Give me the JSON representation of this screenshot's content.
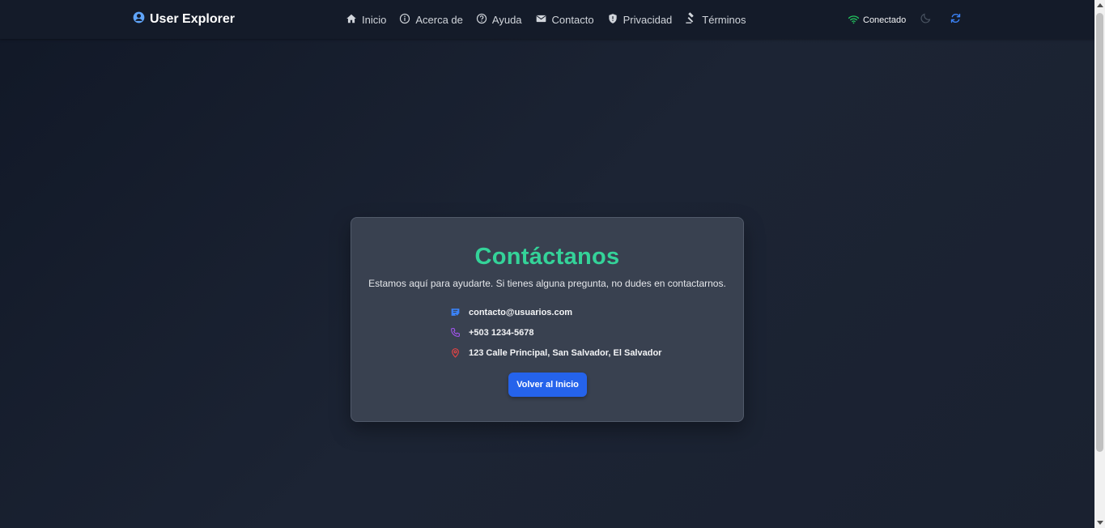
{
  "navbar": {
    "brand": "User Explorer",
    "links": [
      {
        "label": "Inicio",
        "icon": "home-icon"
      },
      {
        "label": "Acerca de",
        "icon": "info-icon"
      },
      {
        "label": "Ayuda",
        "icon": "help-icon"
      },
      {
        "label": "Contacto",
        "icon": "mail-icon"
      },
      {
        "label": "Privacidad",
        "icon": "shield-icon"
      },
      {
        "label": "Términos",
        "icon": "gavel-icon"
      }
    ],
    "status_label": "Conectado"
  },
  "card": {
    "title": "Contáctanos",
    "subtitle": "Estamos aquí para ayudarte. Si tienes alguna pregunta, no dudes en contactarnos.",
    "email": "contacto@usuarios.com",
    "phone": "+503 1234-5678",
    "address": "123 Calle Principal, San Salvador, El Salvador",
    "button_label": "Volver al Inicio"
  },
  "colors": {
    "accent": "#2563eb",
    "title": "#34d399",
    "brand_icon": "#60a5fa",
    "status": "#22c55e",
    "email_icon": "#3b82f6",
    "phone_icon": "#a855f7",
    "address_icon": "#ef4444"
  }
}
